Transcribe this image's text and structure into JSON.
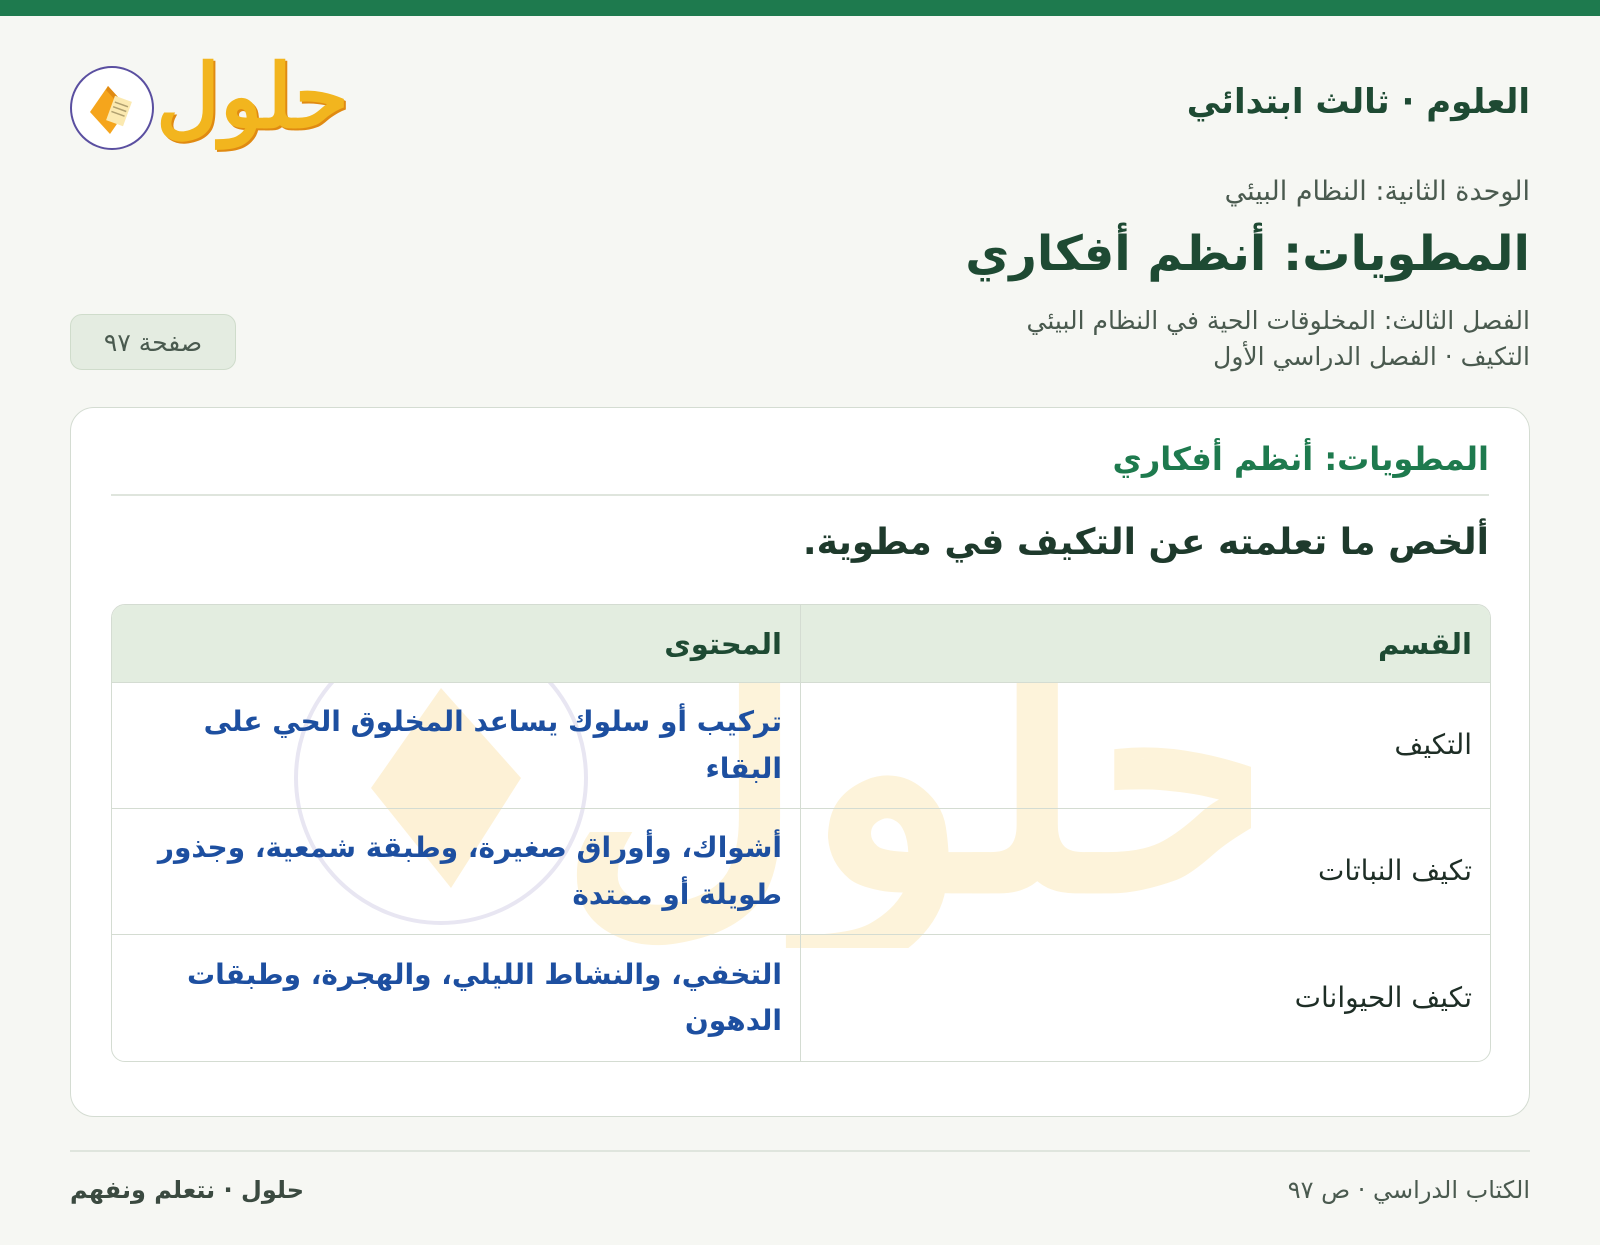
{
  "header": {
    "subject": "العلوم · ثالث ابتدائي",
    "logo_text": "حلول"
  },
  "lesson": {
    "unit": "الوحدة الثانية: النظام البيئي",
    "title": "المطويات: أنظم أفكاري",
    "chapter": "الفصل الثالث: المخلوقات الحية في النظام البيئي",
    "topic": "التكيف · الفصل الدراسي الأول",
    "page_badge": "صفحة ٩٧"
  },
  "card": {
    "title": "المطويات: أنظم أفكاري",
    "prompt": "ألخص ما تعلمته عن التكيف في مطوية.",
    "table": {
      "headers": [
        "القسم",
        "المحتوى"
      ],
      "rows": [
        {
          "section": "التكيف",
          "content": "تركيب أو سلوك يساعد المخلوق الحي على البقاء"
        },
        {
          "section": "تكيف النباتات",
          "content": "أشواك، وأوراق صغيرة، وطبقة شمعية، وجذور طويلة أو ممتدة"
        },
        {
          "section": "تكيف الحيوانات",
          "content": "التخفي، والنشاط الليلي، والهجرة، وطبقات الدهون"
        }
      ]
    }
  },
  "footer": {
    "source": "الكتاب الدراسي · ص ٩٧",
    "brand": "حلول · نتعلم ونفهم"
  },
  "colors": {
    "accent": "#1e7a4e",
    "content_text": "#1d4fa0",
    "logo_gold": "#f2b51e"
  },
  "icons": {
    "logo": "book-icon"
  }
}
